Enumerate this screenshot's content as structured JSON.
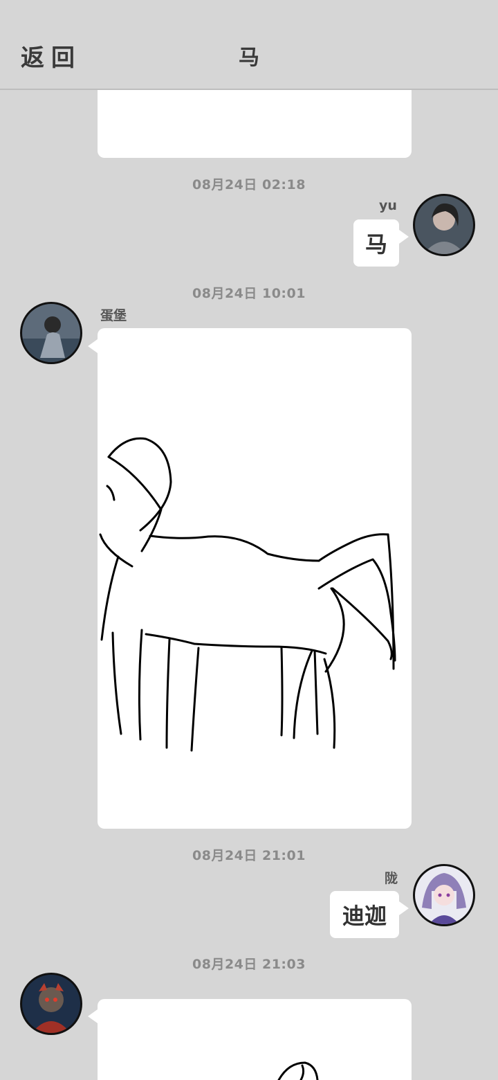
{
  "header": {
    "back_label": "返回",
    "title": "马"
  },
  "messages": [
    {
      "timestamp": "08月24日  02:18",
      "username": "yu",
      "text": "马",
      "avatar_icon": "user-avatar-icon"
    },
    {
      "timestamp": "08月24日  10:01",
      "username": "蛋堡",
      "content": "horse-sketch-image",
      "avatar_icon": "user-avatar-icon"
    },
    {
      "timestamp": "08月24日  21:01",
      "username": "陇",
      "text": "迪迦",
      "avatar_icon": "user-avatar-icon"
    },
    {
      "timestamp": "08月24日  21:03",
      "username": "",
      "content": "sketch-image",
      "avatar_icon": "user-avatar-icon"
    }
  ],
  "colors": {
    "background": "#d6d6d6",
    "bubble": "#ffffff",
    "timestamp": "#8a8a8a"
  }
}
